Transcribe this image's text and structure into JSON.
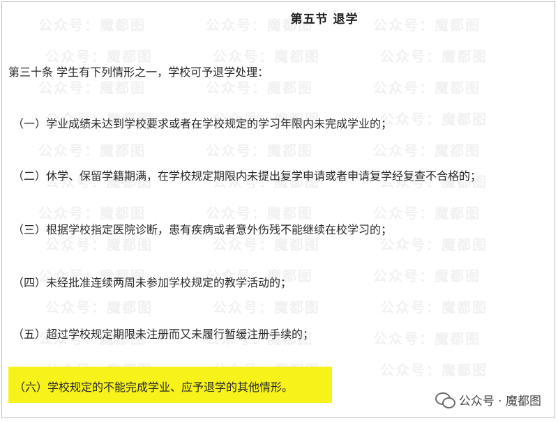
{
  "section_title": "第五节 退学",
  "article_head": "第三十条 学生有下列情形之一，学校可予退学处理：",
  "clauses": [
    "（一）学业成绩未达到学校要求或者在学校规定的学习年限内未完成学业的；",
    "（二）休学、保留学籍期满，在学校规定期限内未提出复学申请或者申请复学经复查不合格的；",
    "（三）根据学校指定医院诊断，患有疾病或者意外伤残不能继续在校学习的；",
    "（四）未经批准连续两周未参加学校规定的教学活动的；",
    "（五）超过学校规定期限未注册而又未履行暂缓注册手续的；",
    "（六）学校规定的不能完成学业、应予退学的其他情形。"
  ],
  "watermark_text": "公众号：魔都图",
  "footer_mark": {
    "text": "公众号 · 魔都图",
    "icon": "wechat-icon"
  },
  "colors": {
    "highlight": "#f6f21a",
    "text": "#2a2a2a"
  }
}
